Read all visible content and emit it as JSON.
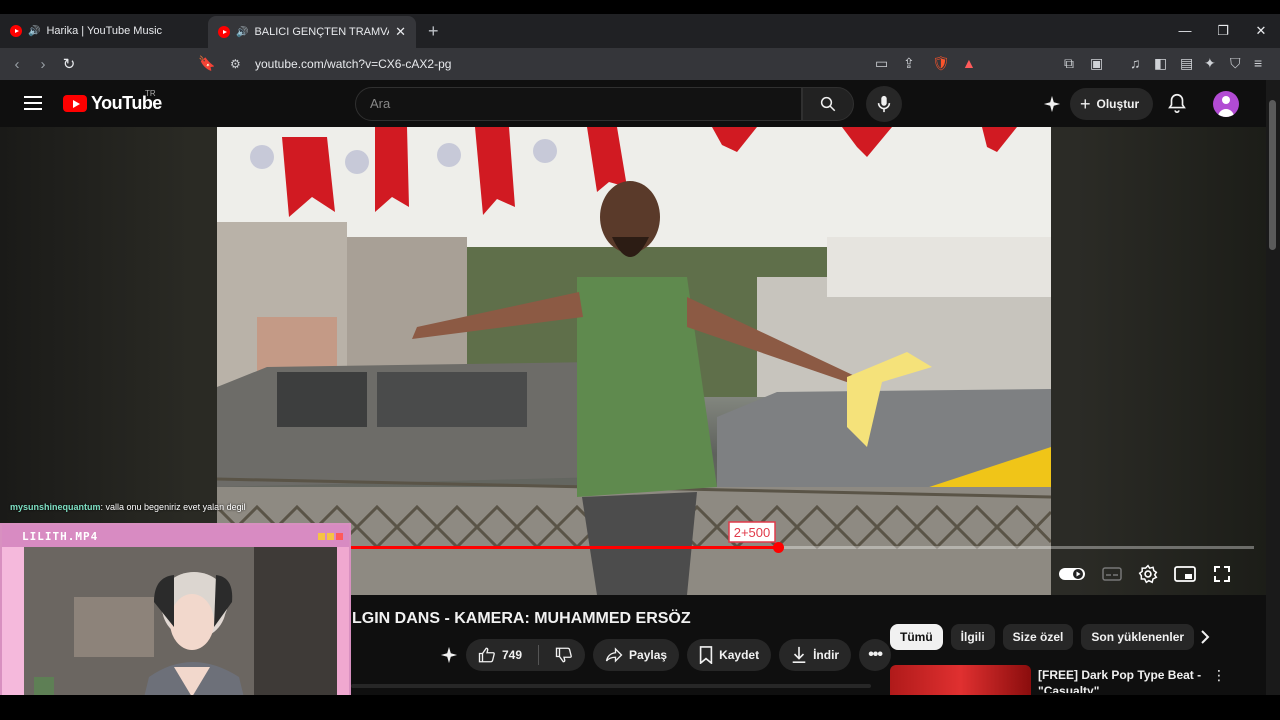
{
  "browser": {
    "tabs": [
      {
        "title": "Harika | YouTube Music",
        "active": false
      },
      {
        "title": "BALICI GENÇTEN TRAMVAY YOLUNDA",
        "active": true
      }
    ],
    "url": "youtube.com/watch?v=CX6-cAX2-pg",
    "new_tab": "+",
    "close_tab": "✕",
    "window_controls": {
      "minimize": "—",
      "restore": "❐",
      "close": "✕"
    }
  },
  "youtube": {
    "logo_text": "YouTube",
    "region": "TR",
    "search_placeholder": "Ara",
    "create_label": "Oluştur"
  },
  "player": {
    "progress_fraction": 0.474,
    "overlay_text": "2+500"
  },
  "stream_overlay": {
    "chat_user": "mysunshinequantum",
    "chat_message": ": valla onu begeniriz evet yalan degil",
    "cam_title": "LILITH.MP4"
  },
  "video": {
    "title": "LGIN DANS - KAMERA: MUHAMMED ERSÖZ",
    "likes": "749",
    "share_label": "Paylaş",
    "save_label": "Kaydet",
    "download_label": "İndir"
  },
  "chips": [
    "Tümü",
    "İlgili",
    "Size özel",
    "Son yüklenenler"
  ],
  "recommendation": {
    "title": "[FREE] Dark Pop Type Beat - \"Casualty\""
  },
  "colors": {
    "accent": "#ff0000",
    "background": "#0f0f0f",
    "cam_frame": "#f0a8d0"
  }
}
